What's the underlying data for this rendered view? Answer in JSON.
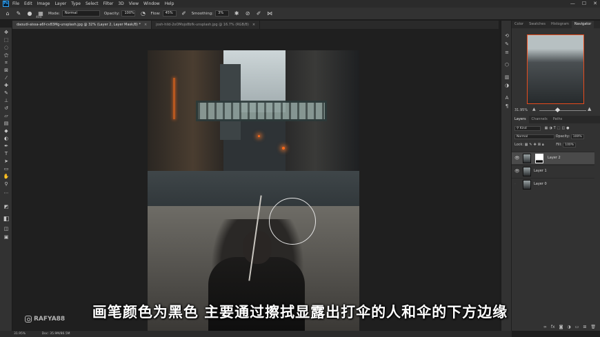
{
  "app": {
    "logo": "Ps"
  },
  "menu": [
    "File",
    "Edit",
    "Image",
    "Layer",
    "Type",
    "Select",
    "Filter",
    "3D",
    "View",
    "Window",
    "Help"
  ],
  "window_controls": [
    "—",
    "☐",
    "✕"
  ],
  "options": {
    "brush_size": "400",
    "mode_label": "Mode:",
    "mode_value": "Normal",
    "opacity_label": "Opacity:",
    "opacity_value": "100%",
    "flow_label": "Flow:",
    "flow_value": "45%",
    "smoothing_label": "Smoothing:",
    "smoothing_value": "3%"
  },
  "tabs": [
    {
      "label": "daoudi-aissa-a6f-cv83Mg-unsplash.jpg @ 32% (Layer 2, Layer Mask/8) *",
      "close": "×"
    },
    {
      "label": "josh-hild-2oOMojo8bfk-unsplash.jpg @ 16.7% (RGB/8)",
      "close": "×"
    }
  ],
  "panel_tabs_top": [
    "Color",
    "Swatches",
    "Histogram",
    "Navigator"
  ],
  "navigator": {
    "zoom": "31.95%"
  },
  "layers_panel": {
    "tabs": [
      "Layers",
      "Channels",
      "Paths"
    ],
    "kind": "Kind",
    "blend": "Normal",
    "opacity_label": "Opacity:",
    "opacity_value": "100%",
    "lock_label": "Lock:",
    "fill_label": "Fill:",
    "fill_value": "100%",
    "layers": [
      {
        "name": "Layer 2",
        "selected": true
      },
      {
        "name": "Layer 1",
        "selected": false
      },
      {
        "name": "Layer 0",
        "selected": false
      }
    ]
  },
  "status": {
    "zoom": "31.95%",
    "doc": "Doc: 35.9M/86.5M"
  },
  "watermark": "RAFYA88",
  "subtitle": "画笔颜色为黑色  主要通过擦拭显露出打伞的人和伞的下方边缘",
  "colors": {
    "accent": "#31a8ff",
    "nav_frame": "#e94c1d"
  }
}
